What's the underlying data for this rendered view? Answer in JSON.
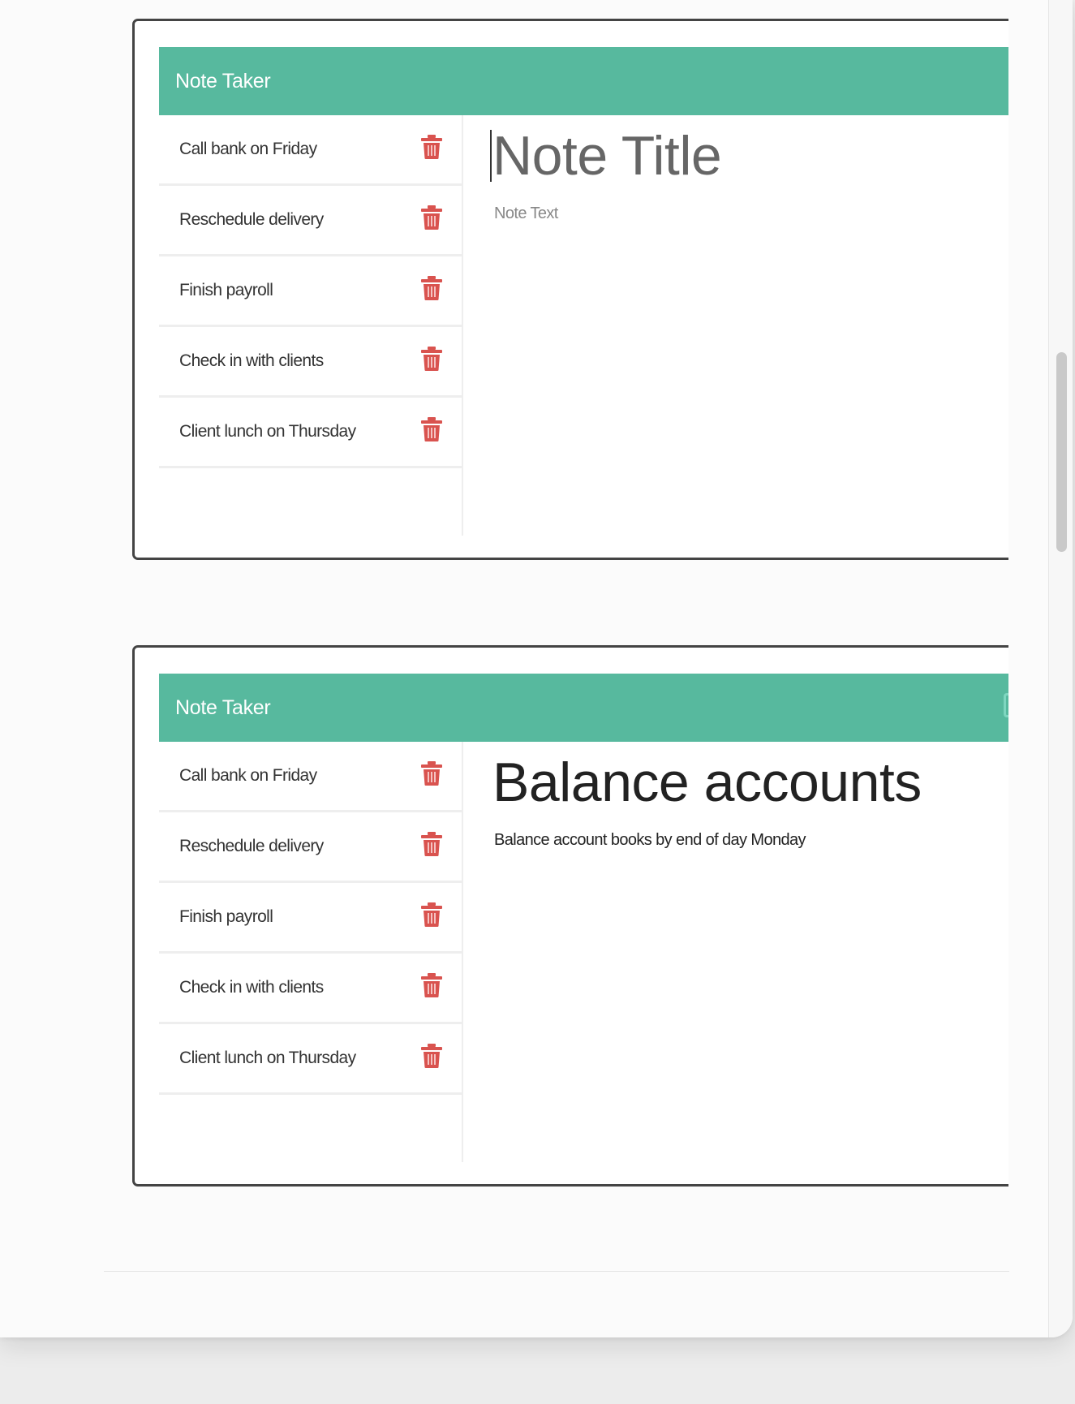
{
  "screens": [
    {
      "app_title": "Note Taker",
      "notes": [
        {
          "title": "Call bank on Friday"
        },
        {
          "title": "Reschedule delivery"
        },
        {
          "title": "Finish payroll"
        },
        {
          "title": "Check in with clients"
        },
        {
          "title": "Client lunch on Thursday"
        }
      ],
      "editor": {
        "title_placeholder": "Note Title",
        "text_placeholder": "Note Text"
      }
    },
    {
      "app_title": "Note Taker",
      "notes": [
        {
          "title": "Call bank on Friday"
        },
        {
          "title": "Reschedule delivery"
        },
        {
          "title": "Finish payroll"
        },
        {
          "title": "Check in with clients"
        },
        {
          "title": "Client lunch on Thursday"
        }
      ],
      "editor": {
        "title": "Balance accounts",
        "text": "Balance account books by end of day Monday"
      }
    }
  ],
  "colors": {
    "navbar": "#57b99e",
    "delete_icon": "#d9534f",
    "frame_border": "#444444"
  },
  "icons": {
    "delete": "trash-icon"
  }
}
